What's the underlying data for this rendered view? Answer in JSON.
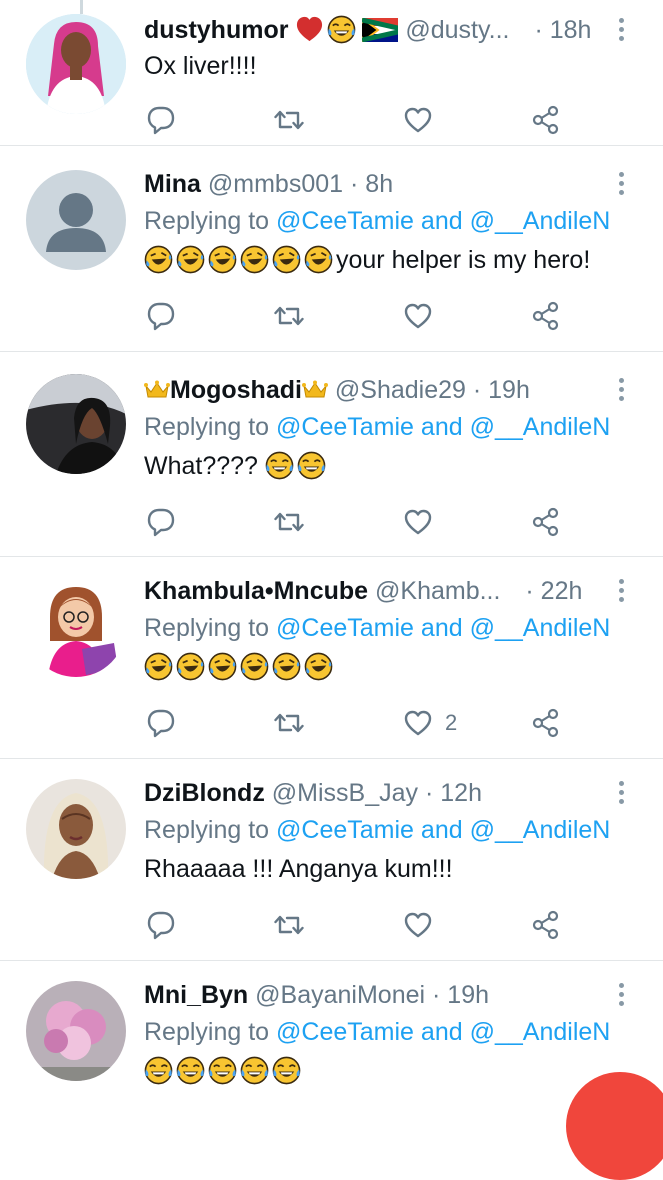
{
  "tweets": [
    {
      "name": "dustyhumor",
      "handle": "@dusty...",
      "time": "· 18h",
      "replying_to": null,
      "text": "Ox liver!!!!",
      "like_count": "",
      "avatar": "avatar-woman-pink-hair"
    },
    {
      "name": "Mina",
      "handle": "@mmbs001",
      "time": "· 8h",
      "replying_to": {
        "prefix": "Replying to",
        "first": "@CeeTamie",
        "conj": "and",
        "second": "@__AndileN"
      },
      "text": "your helper is my hero!",
      "like_count": "",
      "avatar": "default-profile-avatar"
    },
    {
      "name": "Mogoshadi",
      "handle": "@Shadie29",
      "time": "· 19h",
      "replying_to": {
        "prefix": "Replying to",
        "first": "@CeeTamie",
        "conj": "and",
        "second": "@__AndileN"
      },
      "text": "What????",
      "like_count": "",
      "avatar": "avatar-selfie-car"
    },
    {
      "name": "Khambula•Mncube",
      "handle": "@Khamb...",
      "time": "· 22h",
      "replying_to": {
        "prefix": "Replying to",
        "first": "@CeeTamie",
        "conj": "and",
        "second": "@__AndileN"
      },
      "text": "",
      "like_count": "2",
      "avatar": "avatar-cartoon-reader"
    },
    {
      "name": "DziBlondz",
      "handle": "@MissB_Jay",
      "time": "· 12h",
      "replying_to": {
        "prefix": "Replying to",
        "first": "@CeeTamie",
        "conj": "and",
        "second": "@__AndileN"
      },
      "text": "Rhaaaaa !!! Anganya kum!!!",
      "like_count": "",
      "avatar": "avatar-blonde-woman"
    },
    {
      "name": "Mni_Byn",
      "handle": "@BayaniMonei",
      "time": "· 19h",
      "replying_to": {
        "prefix": "Replying to",
        "first": "@CeeTamie",
        "conj": "and",
        "second": "@__AndileN"
      },
      "text": "",
      "like_count": "",
      "avatar": "avatar-pink-flowers"
    }
  ],
  "icons": {
    "reply": "reply-icon",
    "retweet": "retweet-icon",
    "like": "like-icon",
    "share": "share-icon",
    "more": "more-options-icon"
  },
  "colors": {
    "mention": "#1da1f2",
    "secondary_text": "#657786",
    "fab": "#f0463c"
  }
}
